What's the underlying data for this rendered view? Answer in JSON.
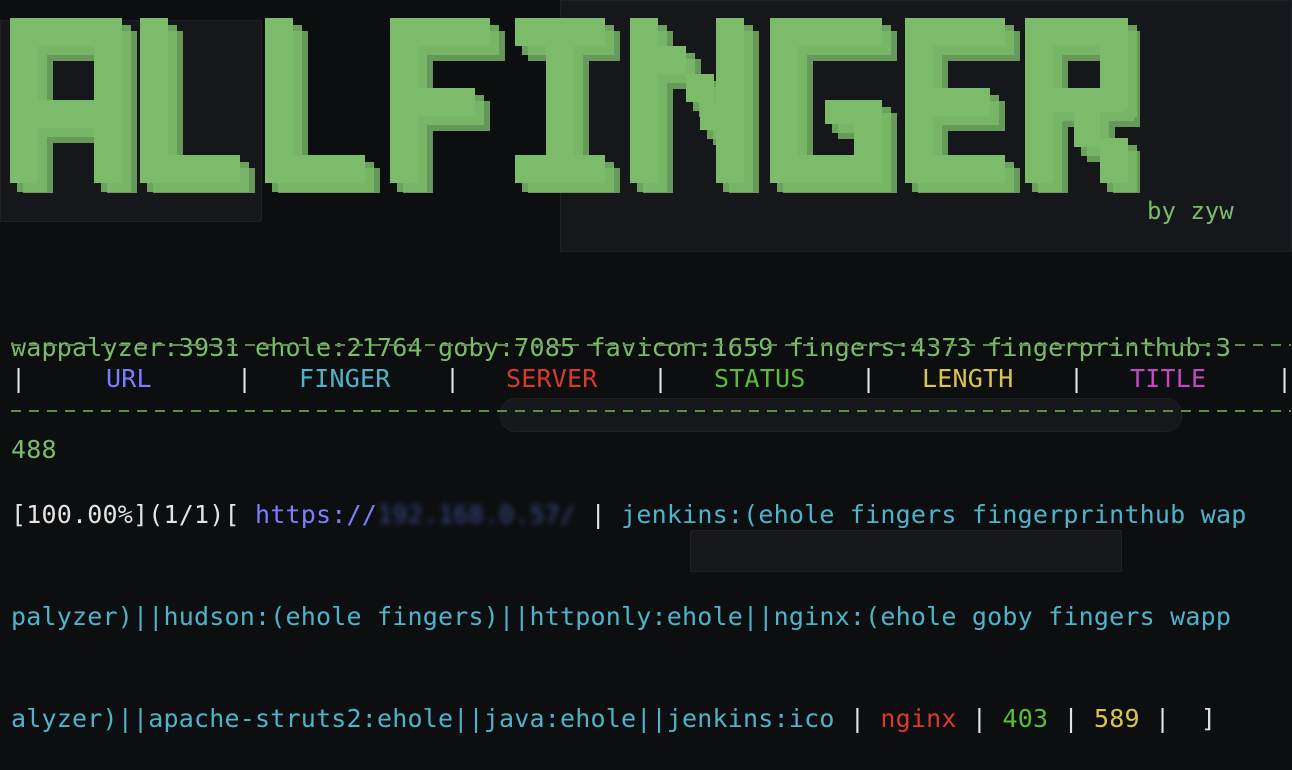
{
  "banner": {
    "text": "ALLFINGER",
    "byline": "by zyw",
    "color": "#7cbb6a"
  },
  "stats_line1": "wappalyzer:3931 ehole:21764 goby:7085 favicon:1659 fingers:4373 fingerprinthub:3",
  "stats_line2": "488",
  "header": {
    "url": "URL",
    "finger": "FINGER",
    "server": "SERVER",
    "status": "STATUS",
    "length": "LENGTH",
    "title": "TITLE"
  },
  "result": {
    "progress": "[100.00%](1/1)[",
    "url": "https://",
    "url_masked": "192.168.0.57/",
    "line1_finger": "jenkins:(ehole fingers fingerprinthub wap",
    "line2": "palyzer)||hudson:(ehole fingers)||httponly:ehole||nginx:(ehole goby fingers wapp",
    "line3_finger": "alyzer)||apache-struts2:ehole||java:ehole||jenkins:ico",
    "server": "nginx",
    "status": "403",
    "length": "589",
    "close": "]"
  },
  "colors": {
    "url": "#7d7dff",
    "finger": "#4fb3c9",
    "server": "#d83a2b",
    "status": "#5dbb3c",
    "length": "#d9c452",
    "title": "#c448c4"
  }
}
